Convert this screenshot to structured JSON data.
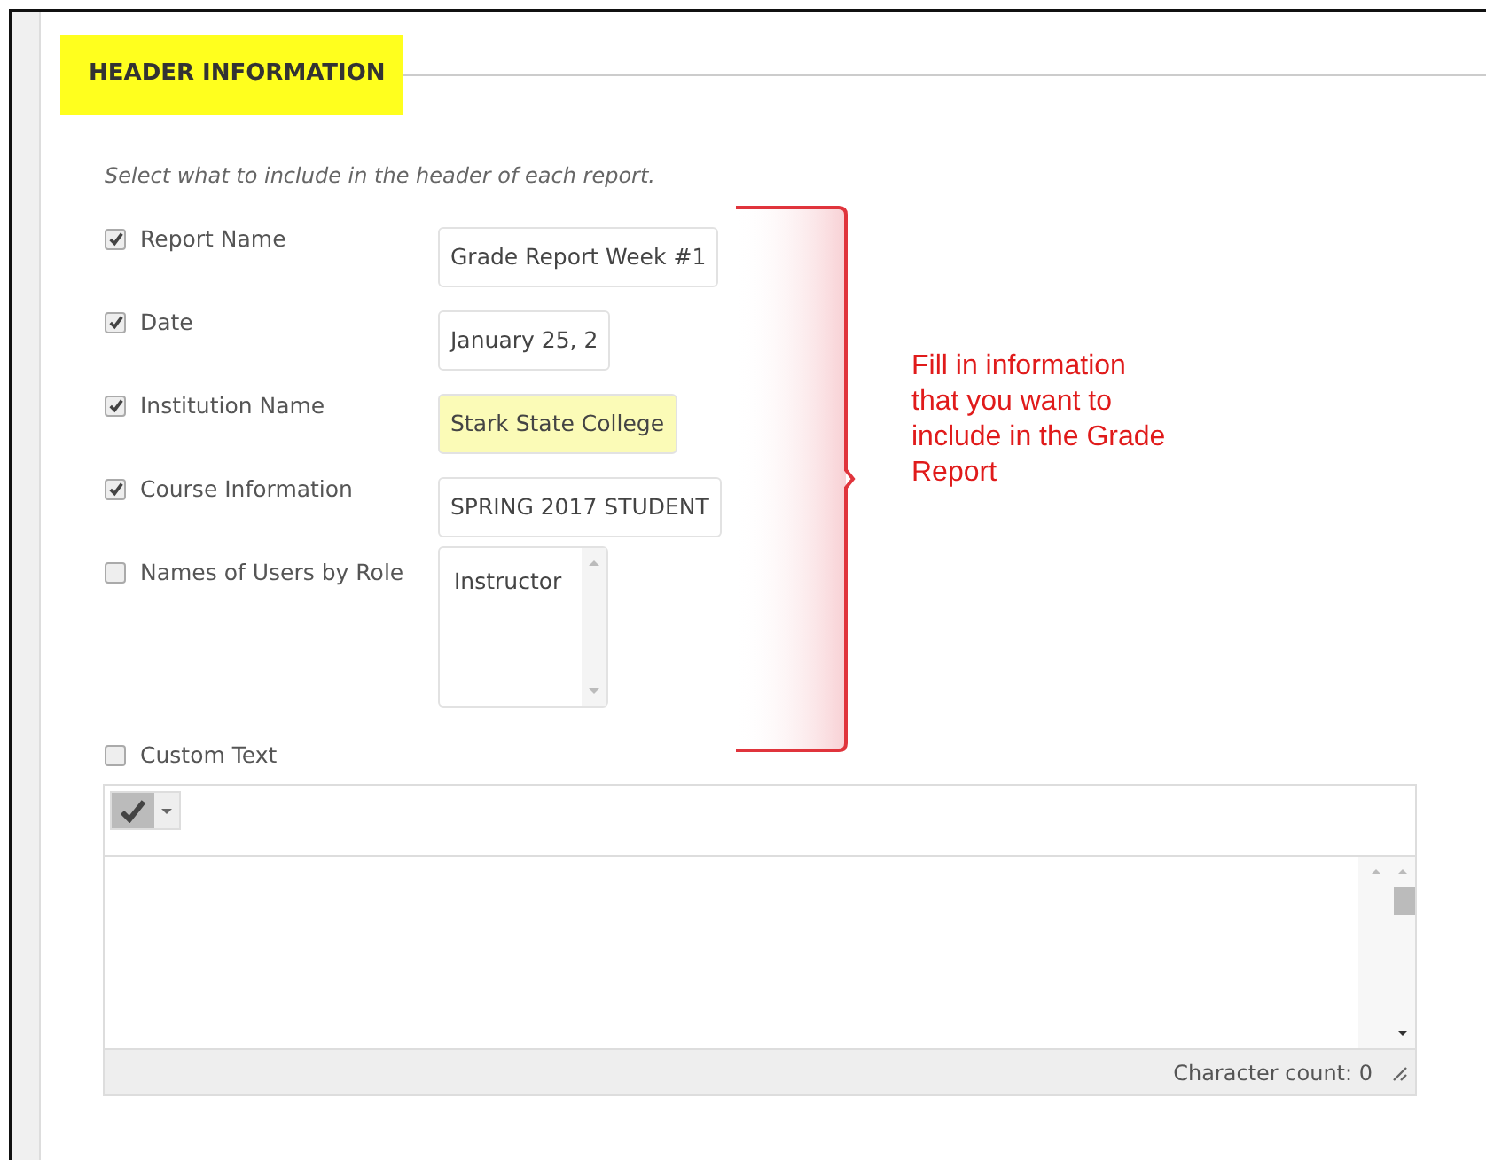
{
  "section": {
    "title": "HEADER INFORMATION",
    "highlighted": true
  },
  "instructions": "Select what to include in the header of each report.",
  "fields": [
    {
      "label": "Report Name",
      "checked": true,
      "kind": "text",
      "value": "Grade Report Week #1",
      "highlighted": false
    },
    {
      "label": "Date",
      "checked": true,
      "kind": "text",
      "value": "January 25, 2",
      "highlighted": false
    },
    {
      "label": "Institution Name",
      "checked": true,
      "kind": "text",
      "value": "Stark State College",
      "highlighted": true
    },
    {
      "label": "Course Information",
      "checked": true,
      "kind": "text",
      "value": "SPRING 2017 STUDENT",
      "highlighted": false
    },
    {
      "label": "Names of Users by Role",
      "checked": false,
      "kind": "list",
      "value": "Instructor",
      "highlighted": false
    }
  ],
  "custom_text": {
    "label": "Custom Text",
    "checked": false,
    "character_count": "Character count: 0"
  },
  "annotation": {
    "text": "Fill in information that you want to include in the Grade Report"
  }
}
